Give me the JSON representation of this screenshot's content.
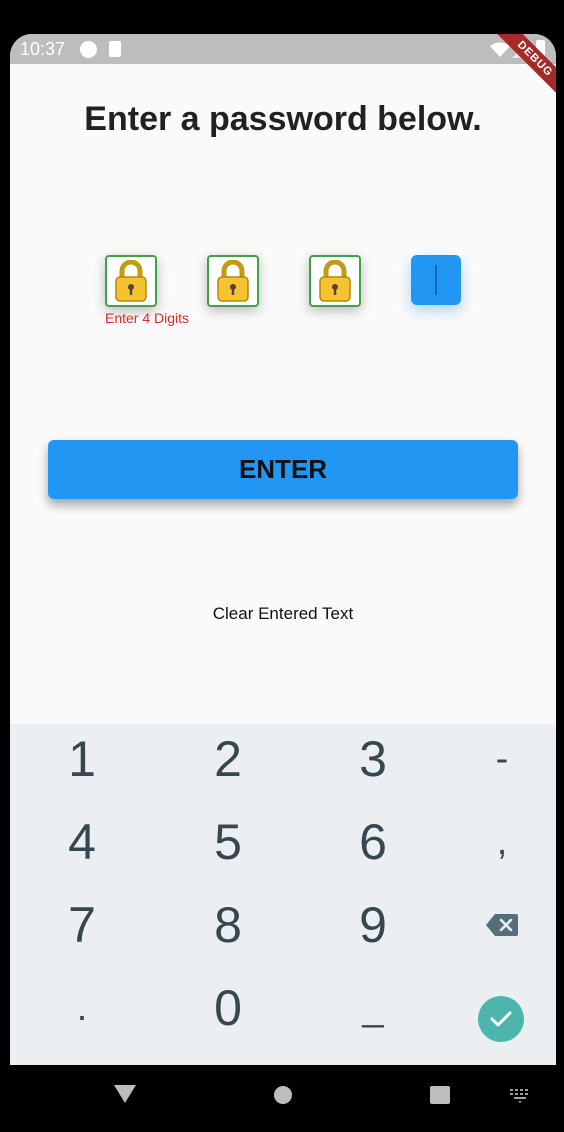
{
  "status_bar": {
    "time": "10:37"
  },
  "debug_banner": "DEBUG",
  "title": "Enter a password below.",
  "pin": {
    "boxes": [
      {
        "state": "filled",
        "icon": "padlock-icon"
      },
      {
        "state": "filled",
        "icon": "padlock-icon"
      },
      {
        "state": "filled",
        "icon": "padlock-icon"
      },
      {
        "state": "active"
      }
    ],
    "error": "Enter 4 Digits"
  },
  "enter_button": "ENTER",
  "clear_link": "Clear Entered Text",
  "keyboard": {
    "rows": [
      [
        "1",
        "2",
        "3",
        "-"
      ],
      [
        "4",
        "5",
        "6",
        ","
      ],
      [
        "7",
        "8",
        "9",
        "backspace"
      ],
      [
        ".",
        "0",
        "_",
        "done"
      ]
    ]
  },
  "colors": {
    "accent": "#2196f3",
    "error": "#d32f2f",
    "box_border": "#43a047",
    "done_key": "#4db6ac",
    "keyboard_bg": "#eceff1"
  }
}
